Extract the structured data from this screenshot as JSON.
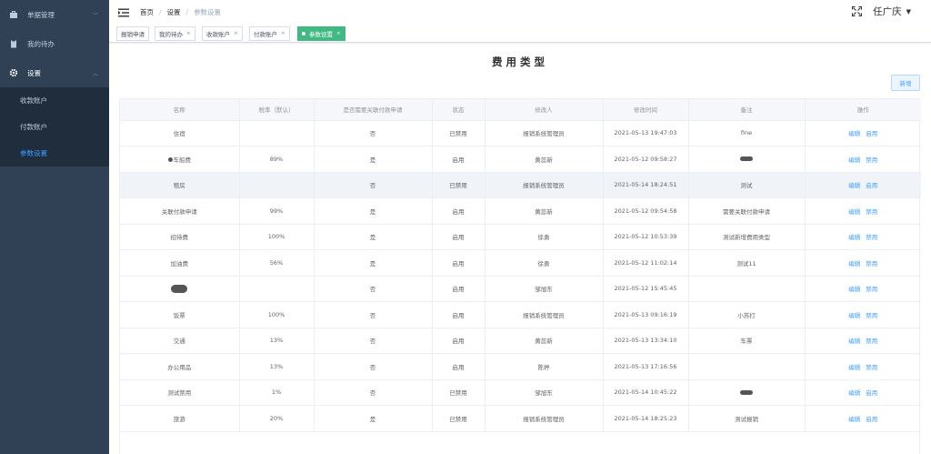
{
  "sidebar": {
    "menu": [
      {
        "label": "单据管理",
        "icon": "briefcase-icon"
      },
      {
        "label": "我的待办",
        "icon": "clipboard-icon"
      },
      {
        "label": "设置",
        "icon": "gear-icon"
      }
    ],
    "submenu": [
      {
        "label": "收款账户"
      },
      {
        "label": "付款账户"
      },
      {
        "label": "参数设置"
      }
    ]
  },
  "header": {
    "breadcrumb": [
      "首页",
      "设置",
      "参数设置"
    ],
    "user": "任广庆"
  },
  "tags": [
    "报销申请",
    "我的待办",
    "收款账户",
    "付款账户",
    "参数设置"
  ],
  "page": {
    "title": "费用类型",
    "add_button": "新增"
  },
  "table": {
    "columns": [
      "名称",
      "税率（默认）",
      "是否需要关联付款申请",
      "状态",
      "修改人",
      "修改时间",
      "备注",
      "操作"
    ],
    "rows": [
      {
        "name": "住宿",
        "rate": "",
        "need": "否",
        "status": "已禁用",
        "modifier": "报销系统管理员",
        "time": "2021-05-13 19:47:03",
        "note": "fine",
        "edit": "编辑",
        "toggle": "启用"
      },
      {
        "name": "车船费",
        "rate": "89%",
        "need": "是",
        "status": "启用",
        "modifier": "黄蕊新",
        "time": "2021-05-12 09:58:27",
        "note": "",
        "edit": "编辑",
        "toggle": "禁用"
      },
      {
        "name": "租房",
        "rate": "",
        "need": "否",
        "status": "已禁用",
        "modifier": "报销系统管理员",
        "time": "2021-05-14 18:24:51",
        "note": "测试",
        "edit": "编辑",
        "toggle": "启用"
      },
      {
        "name": "关联付款申请",
        "rate": "99%",
        "need": "是",
        "status": "启用",
        "modifier": "黄蕊新",
        "time": "2021-05-12 09:54:58",
        "note": "需要关联付款申请",
        "edit": "编辑",
        "toggle": "禁用"
      },
      {
        "name": "招待费",
        "rate": "100%",
        "need": "是",
        "status": "启用",
        "modifier": "徐勇",
        "time": "2021-05-12 10:53:39",
        "note": "测试新增费用类型",
        "edit": "编辑",
        "toggle": "禁用"
      },
      {
        "name": "加油费",
        "rate": "56%",
        "need": "是",
        "status": "启用",
        "modifier": "徐勇",
        "time": "2021-05-12 11:02:14",
        "note": "测试11",
        "edit": "编辑",
        "toggle": "禁用"
      },
      {
        "name": "",
        "rate": "",
        "need": "否",
        "status": "启用",
        "modifier": "邹旭东",
        "time": "2021-05-12 15:45:45",
        "note": "",
        "edit": "编辑",
        "toggle": "禁用"
      },
      {
        "name": "饭票",
        "rate": "100%",
        "need": "否",
        "status": "启用",
        "modifier": "报销系统管理员",
        "time": "2021-05-13 09:16:19",
        "note": "小苏打",
        "edit": "编辑",
        "toggle": "禁用"
      },
      {
        "name": "交通",
        "rate": "13%",
        "need": "否",
        "status": "启用",
        "modifier": "黄蕊新",
        "time": "2021-05-13 13:34:10",
        "note": "车票",
        "edit": "编辑",
        "toggle": "禁用"
      },
      {
        "name": "办公用品",
        "rate": "13%",
        "need": "否",
        "status": "启用",
        "modifier": "陈婷",
        "time": "2021-05-13 17:16:56",
        "note": "",
        "edit": "编辑",
        "toggle": "禁用"
      },
      {
        "name": "测试禁用",
        "rate": "1%",
        "need": "否",
        "status": "已禁用",
        "modifier": "邹旭东",
        "time": "2021-05-14 10:45:22",
        "note": "",
        "edit": "编辑",
        "toggle": "启用"
      },
      {
        "name": "旅游",
        "rate": "20%",
        "need": "是",
        "status": "已禁用",
        "modifier": "报销系统管理员",
        "time": "2021-05-14 18:25:23",
        "note": "测试报销",
        "edit": "编辑",
        "toggle": "启用"
      }
    ]
  },
  "colors": {
    "sidebar_bg": "#304156",
    "submenu_bg": "#1f2d3d",
    "accent": "#409eff",
    "tag_active": "#42b983"
  }
}
